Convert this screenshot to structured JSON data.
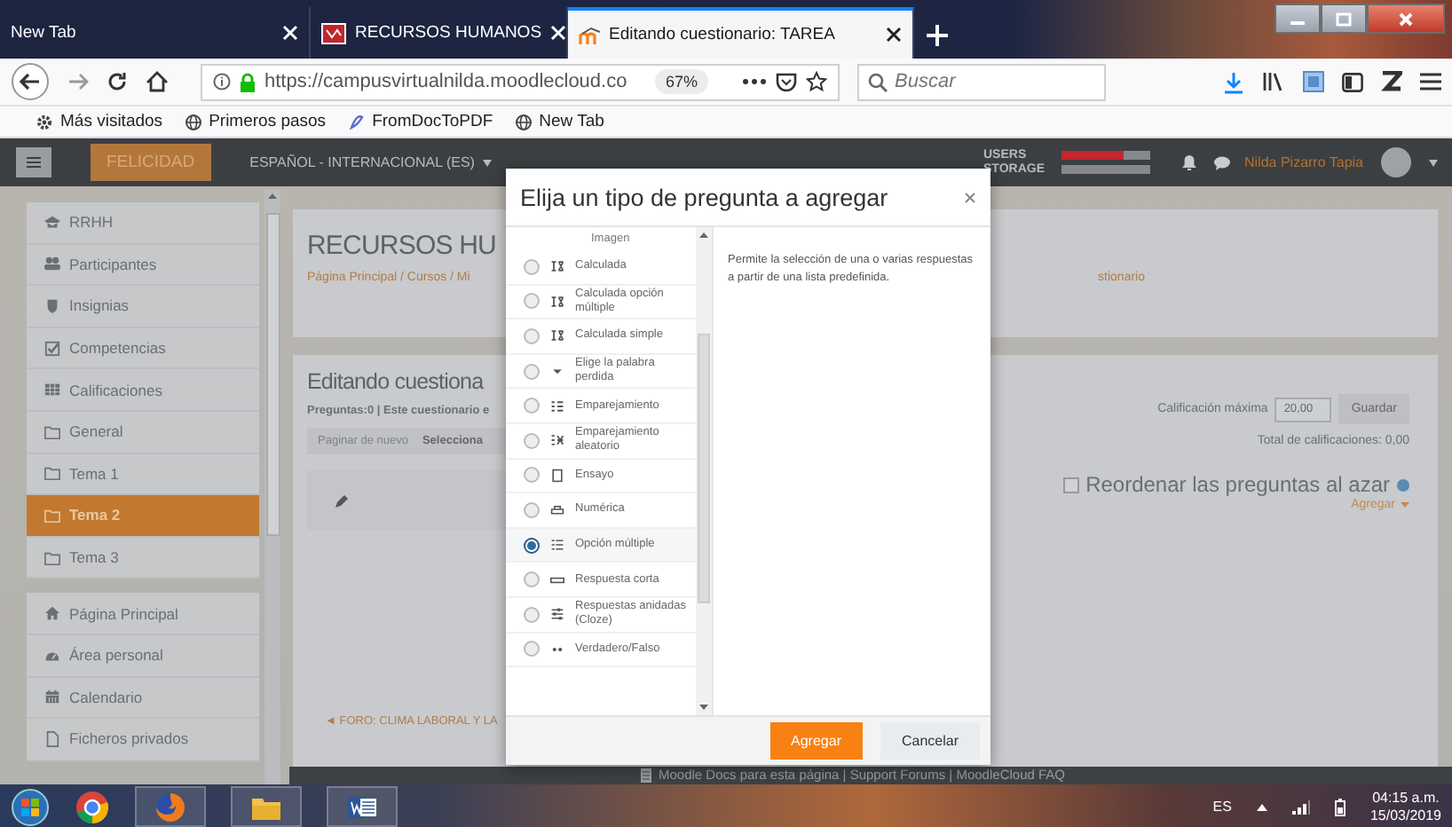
{
  "browser": {
    "tabs": [
      {
        "title": "New Tab",
        "kind": "blank",
        "selected": false
      },
      {
        "title": "RECURSOS HUMANOS",
        "kind": "document",
        "selected": false
      },
      {
        "title": "Editando cuestionario: TAREA",
        "kind": "moodle",
        "selected": true
      }
    ],
    "url": "https://campusvirtualnilda.moodlecloud.co",
    "zoom": "67%",
    "search_placeholder": "Buscar",
    "bookmarks": [
      {
        "label": "Más visitados",
        "kind": "gear"
      },
      {
        "label": "Primeros pasos",
        "kind": "globe"
      },
      {
        "label": "FromDocToPDF",
        "kind": "pdf"
      },
      {
        "label": "New Tab",
        "kind": "globe"
      }
    ]
  },
  "moodle_header": {
    "site": "FELICIDAD",
    "language": "ESPAÑOL - INTERNACIONAL (ES)",
    "usage": [
      {
        "label": "USERS",
        "level": 0.7
      },
      {
        "label": "STORAGE",
        "level": 0
      }
    ],
    "user_name": "Nilda Pizarro Tapia"
  },
  "sidebar": {
    "groups": [
      [
        {
          "label": "RRHH",
          "kind": "course",
          "selected": false
        },
        {
          "label": "Participantes",
          "kind": "people",
          "selected": false
        },
        {
          "label": "Insignias",
          "kind": "shield",
          "selected": false
        },
        {
          "label": "Competencias",
          "kind": "check",
          "selected": false
        },
        {
          "label": "Calificaciones",
          "kind": "table",
          "selected": false
        },
        {
          "label": "General",
          "kind": "folder",
          "selected": false
        },
        {
          "label": "Tema 1",
          "kind": "folder",
          "selected": false
        },
        {
          "label": "Tema 2",
          "kind": "folder",
          "selected": true
        },
        {
          "label": "Tema 3",
          "kind": "folder",
          "selected": false
        }
      ],
      [
        {
          "label": "Página Principal",
          "kind": "home",
          "selected": false
        },
        {
          "label": "Área personal",
          "kind": "dashboard",
          "selected": false
        },
        {
          "label": "Calendario",
          "kind": "calendar",
          "selected": false
        },
        {
          "label": "Ficheros privados",
          "kind": "file",
          "selected": false
        }
      ]
    ]
  },
  "course_header": {
    "title": "RECURSOS HU",
    "breadcrumb": "Página Principal / Cursos / Mi",
    "breadcrumb_end": "stionario"
  },
  "quiz": {
    "title": "Editando cuestiona",
    "info": "Preguntas:0 | Este cuestionario e",
    "repaginate": "Paginar de nuevo",
    "select": "Selecciona",
    "max_grade_label": "Calificación máxima",
    "max_grade": "20,00",
    "save": "Guardar",
    "total": "Total de calificaciones: 0,00",
    "shuffle": {
      "label": "Reordenar las preguntas al azar",
      "checked": false
    },
    "add": "Agregar",
    "prev_activity": "◄ FORO: CLIMA LABORAL Y LA"
  },
  "modal": {
    "title": "Elija un tipo de pregunta a agregar",
    "top_cut_label": "Imagen",
    "options": [
      {
        "label": "Calculada",
        "kind": "calculated",
        "selected": false
      },
      {
        "label": "Calculada opción múltiple",
        "kind": "calculated",
        "selected": false
      },
      {
        "label": "Calculada simple",
        "kind": "calculated",
        "selected": false
      },
      {
        "label": "Elige la palabra perdida",
        "kind": "dropdown",
        "selected": false
      },
      {
        "label": "Emparejamiento",
        "kind": "matching",
        "selected": false
      },
      {
        "label": "Emparejamiento aleatorio",
        "kind": "random",
        "selected": false
      },
      {
        "label": "Ensayo",
        "kind": "essay",
        "selected": false
      },
      {
        "label": "Numérica",
        "kind": "numeric",
        "selected": false
      },
      {
        "label": "Opción múltiple",
        "kind": "list",
        "selected": true
      },
      {
        "label": "Respuesta corta",
        "kind": "short",
        "selected": false
      },
      {
        "label": "Respuestas anidadas (Cloze)",
        "kind": "sliders",
        "selected": false
      },
      {
        "label": "Verdadero/Falso",
        "kind": "dots",
        "selected": false
      }
    ],
    "description": "Permite la selección de una o varias respuestas a partir de una lista predefinida.",
    "buttons": [
      {
        "label": "Agregar",
        "kind": "primary"
      },
      {
        "label": "Cancelar",
        "kind": "secondary"
      }
    ]
  },
  "footer": "Moodle Docs para esta página | Support Forums | MoodleCloud FAQ",
  "taskbar": {
    "language": "ES",
    "time": "04:15 a.m.",
    "date": "15/03/2019"
  }
}
